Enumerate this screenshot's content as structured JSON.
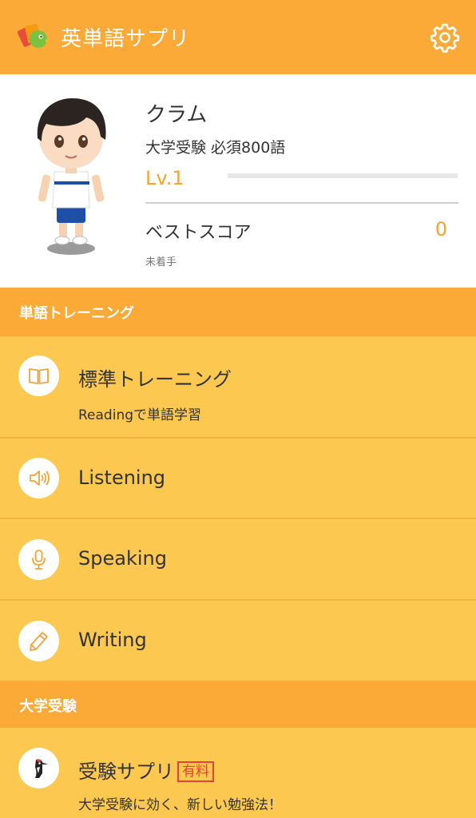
{
  "appbar": {
    "title": "英単語サプリ",
    "logo_icon": "app-logo-icon",
    "settings_icon": "gear-icon",
    "color": "#fba937"
  },
  "profile": {
    "name": "クラム",
    "course": "大学受験 必須800語",
    "level": "Lv.1",
    "level_progress": 0,
    "best_score_label": "ベストスコア",
    "best_score": "0",
    "status": "未着手",
    "accent": "#f7a32c"
  },
  "training": {
    "header": "単語トレーニング",
    "items": [
      {
        "label": "標準トレーニング",
        "subtitle": "Readingで単語学習",
        "icon": "book-icon"
      },
      {
        "label": "Listening",
        "icon": "speaker-icon"
      },
      {
        "label": "Speaking",
        "icon": "microphone-icon"
      },
      {
        "label": "Writing",
        "icon": "pencil-icon"
      }
    ]
  },
  "exam": {
    "header": "大学受験",
    "items": [
      {
        "label": "受験サプリ",
        "badge": "有料",
        "subtitle": "大学受験に効く、新しい勉強法！",
        "icon": "woodpecker-icon"
      }
    ]
  }
}
